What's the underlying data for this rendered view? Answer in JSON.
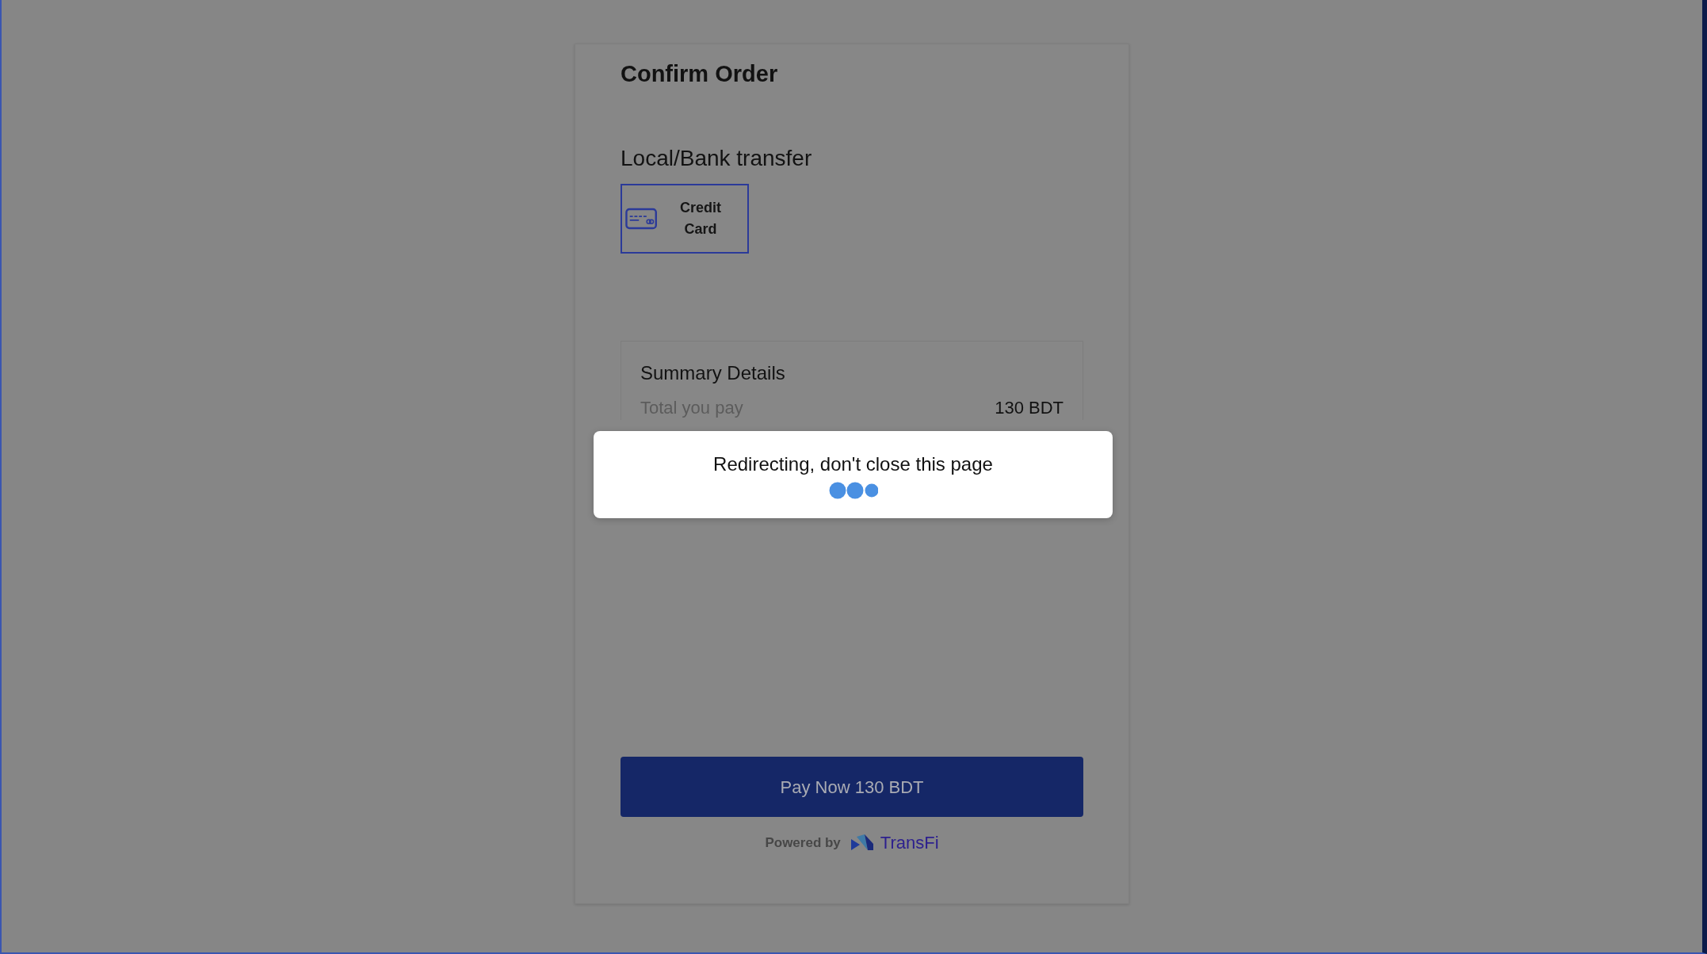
{
  "title": "Confirm Order",
  "section_title": "Local/Bank transfer",
  "payment_methods": [
    {
      "label": "Credit Card",
      "selected": true
    }
  ],
  "summary": {
    "title": "Summary Details",
    "rows": [
      {
        "label": "Total you pay",
        "value": "130 BDT"
      }
    ]
  },
  "pay_button": "Pay Now 130 BDT",
  "footer": {
    "powered_by": "Powered by",
    "brand": "TransFi"
  },
  "modal": {
    "message": "Redirecting, don't close this page"
  }
}
